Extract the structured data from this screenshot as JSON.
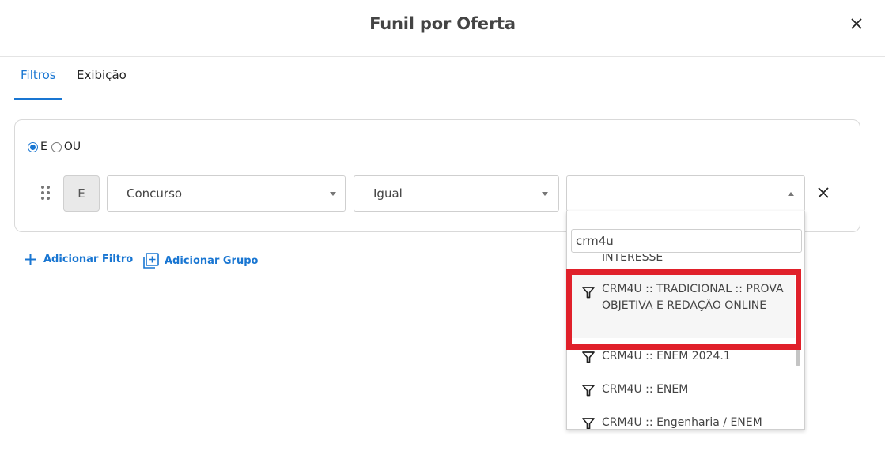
{
  "modal": {
    "title": "Funil por Oferta"
  },
  "tabs": [
    {
      "label": "Filtros",
      "active": true
    },
    {
      "label": "Exibição",
      "active": false
    }
  ],
  "filters": {
    "logic": {
      "options": [
        {
          "label": "E",
          "checked": true
        },
        {
          "label": "OU",
          "checked": false
        }
      ]
    },
    "row": {
      "connector": "E",
      "field": "Concurso",
      "operator": "Igual",
      "value": ""
    }
  },
  "actions": {
    "add_filter": "Adicionar Filtro",
    "add_group": "Adicionar Grupo"
  },
  "dropdown": {
    "search_value": "crm4u",
    "options": [
      {
        "label": "INTERESSE",
        "clipped": true
      },
      {
        "label": "CRM4U :: TRADICIONAL :: PROVA OBJETIVA E REDAÇÃO ONLINE",
        "highlighted": true
      },
      {
        "label": "CRM4U :: ENEM 2024.1"
      },
      {
        "label": "CRM4U :: ENEM"
      },
      {
        "label": "CRM4U :: Engenharia / ENEM",
        "clipped": true
      }
    ]
  },
  "colors": {
    "accent": "#1976d2",
    "highlight_box": "#e0202a"
  },
  "icons": {
    "close": "close-icon",
    "drag": "drag-handle-icon",
    "filter_option": "filter-icon",
    "add": "plus-icon",
    "add_group": "add-box-icon"
  }
}
